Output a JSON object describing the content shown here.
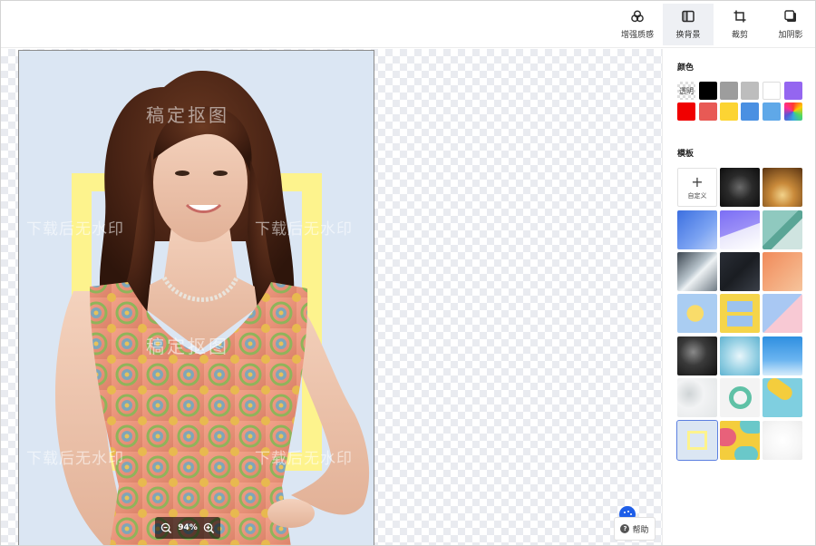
{
  "toolbar": {
    "tools": [
      {
        "label": "增强质感",
        "icon": "enhance-icon"
      },
      {
        "label": "换背景",
        "icon": "background-icon",
        "active": true
      },
      {
        "label": "裁剪",
        "icon": "crop-icon"
      },
      {
        "label": "加阴影",
        "icon": "shadow-icon"
      }
    ]
  },
  "canvas": {
    "watermarks": [
      "稿定抠图",
      "下载后无水印",
      "下载后无水印",
      "稿定抠图",
      "下载后无水印",
      "下载后无水印"
    ],
    "zoom_level": "94%",
    "help_label": "帮助"
  },
  "panel": {
    "color_title": "颜色",
    "transparent_label": "透明",
    "colors": [
      "#000000",
      "#9d9d9d",
      "#bdbdbd",
      "#ffffff",
      "#9466f0",
      "#f00000",
      "#e85a55",
      "#fcd433",
      "#4a90e2",
      "#5fa8e8"
    ],
    "template_title": "模板",
    "custom_label": "自定义",
    "templates": [
      "dark-spotlight",
      "gold-bokeh",
      "blue-gradient",
      "purple-waves",
      "teal-shapes",
      "silver-light",
      "dark-texture",
      "orange-gradient",
      "blue-circle",
      "yellow-squares",
      "pink-diagonal",
      "black-marble",
      "blue-glitter",
      "sky-blue",
      "white-leaves",
      "green-ring",
      "yellow-pill",
      "yellow-frame",
      "color-blobs",
      "white-soft"
    ]
  },
  "colors": {
    "accent": "#1e5ee8",
    "frame_yellow": "#fdf38d",
    "photo_bg": "#dbe6f3"
  }
}
